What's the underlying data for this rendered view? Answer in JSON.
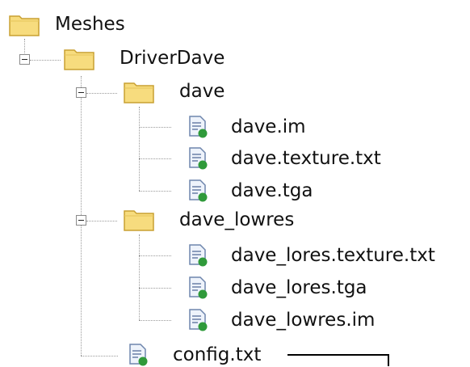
{
  "tree": {
    "root": {
      "label": "Meshes",
      "icon": "folder-icon"
    },
    "folder_driverdave": {
      "label": "DriverDave",
      "icon": "folder-icon",
      "expander": "minus"
    },
    "folder_dave": {
      "label": "dave",
      "icon": "folder-icon",
      "expander": "minus"
    },
    "file_dave_im": {
      "label": "dave.im",
      "icon": "file-icon"
    },
    "file_dave_texture": {
      "label": "dave.texture.txt",
      "icon": "file-icon"
    },
    "file_dave_tga": {
      "label": "dave.tga",
      "icon": "file-icon"
    },
    "folder_dave_lowres": {
      "label": "dave_lowres",
      "icon": "folder-icon",
      "expander": "minus"
    },
    "file_lores_texture": {
      "label": "dave_lores.texture.txt",
      "icon": "file-icon"
    },
    "file_lores_tga": {
      "label": "dave_lores.tga",
      "icon": "file-icon"
    },
    "file_lowres_im": {
      "label": "dave_lowres.im",
      "icon": "file-icon"
    },
    "file_config": {
      "label": "config.txt",
      "icon": "file-icon"
    }
  },
  "colors": {
    "folder_fill": "#f7dc7e",
    "folder_stroke": "#c8a032",
    "file_page": "#eef3fb",
    "file_stroke": "#6f86ad",
    "file_lines": "#6a7fa8",
    "file_badge": "#2f9a3a",
    "connector": "#9a9a9a",
    "callout": "#000000"
  }
}
